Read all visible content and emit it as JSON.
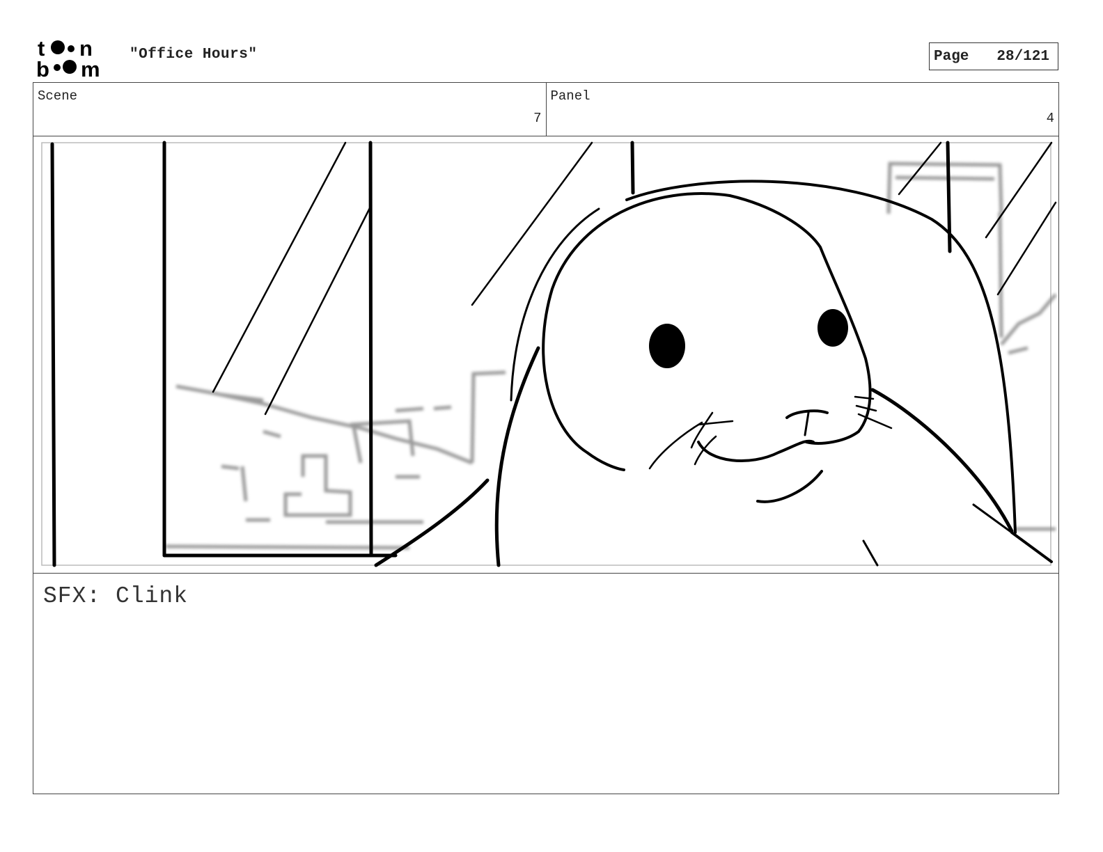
{
  "header": {
    "logo_text": "toon boom",
    "title": "\"Office Hours\"",
    "page_label": "Page",
    "page_number": "28/121"
  },
  "meta": {
    "scene_label": "Scene",
    "scene_value": "7",
    "panel_label": "Panel",
    "panel_value": "4"
  },
  "panel": {
    "image_icon": "storyboard-sketch-seal-character"
  },
  "caption": {
    "text": "SFX: Clink"
  }
}
